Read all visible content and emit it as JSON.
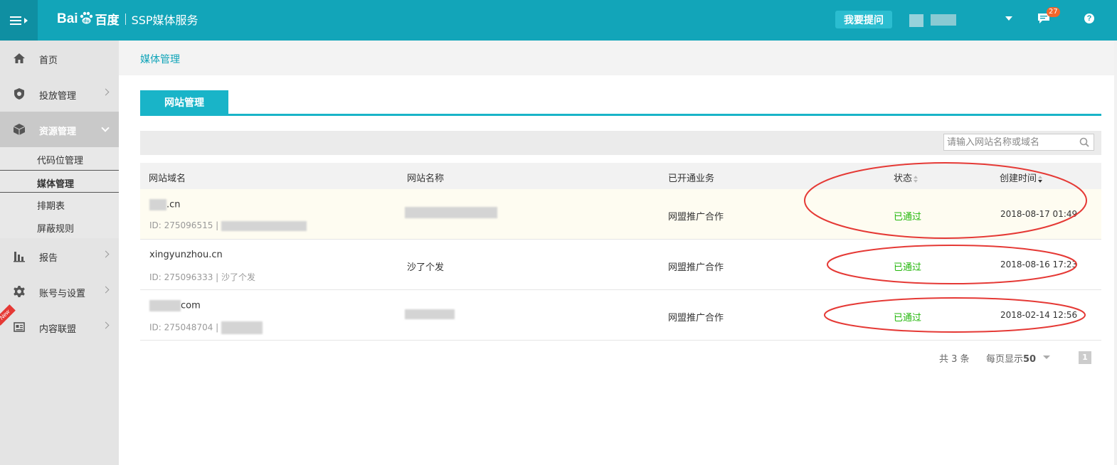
{
  "header": {
    "logo_text": "Bai",
    "logo_text_2": "du",
    "logo_cn": "百度",
    "service_name": "SSP媒体服务",
    "ask_button": "我要提问",
    "message_count": "27",
    "help_icon": "?"
  },
  "colors": {
    "topbar": "#12a5b9",
    "accent": "#19b4c8",
    "status_green": "#23b70b",
    "annotation_red": "#e53935"
  },
  "sidebar": {
    "items": [
      {
        "label": "首页",
        "icon": "home-icon"
      },
      {
        "label": "投放管理",
        "icon": "shield-icon"
      },
      {
        "label": "资源管理",
        "icon": "box-icon"
      },
      {
        "label": "报告",
        "icon": "bar-chart-icon"
      },
      {
        "label": "账号与设置",
        "icon": "gear-icon"
      },
      {
        "label": "内容联盟",
        "icon": "news-icon"
      }
    ],
    "sub_items": [
      {
        "label": "代码位管理"
      },
      {
        "label": "媒体管理"
      },
      {
        "label": "排期表"
      },
      {
        "label": "屏蔽规则"
      }
    ],
    "new_badge": "New"
  },
  "breadcrumb": "媒体管理",
  "tab": "网站管理",
  "search": {
    "placeholder": "请输入网站名称或域名"
  },
  "table": {
    "headers": [
      "网站域名",
      "网站名称",
      "已开通业务",
      "状态",
      "创建时间"
    ],
    "rows": [
      {
        "domain": ".cn",
        "id": "ID: 275096515 |",
        "name": "",
        "business": "网盟推广合作",
        "status": "已通过",
        "created": "2018-08-17 01:49"
      },
      {
        "domain": "xingyunzhou.cn",
        "id": "ID: 275096333 | 沙了个发",
        "name": "沙了个发",
        "business": "网盟推广合作",
        "status": "已通过",
        "created": "2018-08-16 17:23"
      },
      {
        "domain": "com",
        "id": "ID: 275048704 |",
        "name": "",
        "business": "网盟推广合作",
        "status": "已通过",
        "created": "2018-02-14 12:56"
      }
    ]
  },
  "pager": {
    "total": "共 3 条",
    "per_page_label": "每页显示",
    "per_page_value": "50",
    "current_page": "1"
  }
}
